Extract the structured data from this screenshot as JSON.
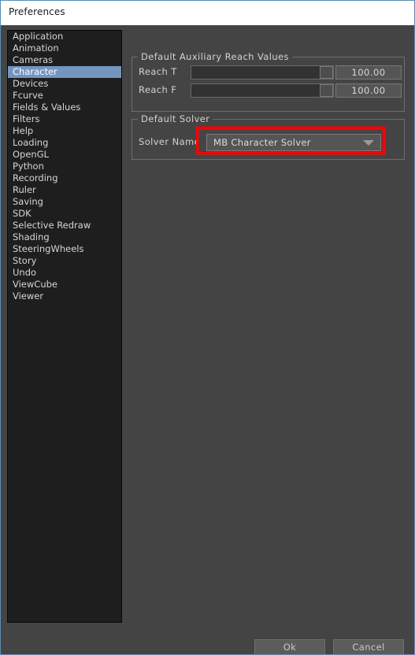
{
  "window": {
    "title": "Preferences",
    "accent_border_color": "#2f9ae0",
    "background_color": "#444444",
    "titlebar_background": "#ffffff"
  },
  "sidebar": {
    "selected": "Character",
    "selected_color": "#7395bf",
    "items": [
      {
        "label": "Application"
      },
      {
        "label": "Animation"
      },
      {
        "label": "Cameras"
      },
      {
        "label": "Character"
      },
      {
        "label": "Devices"
      },
      {
        "label": "Fcurve"
      },
      {
        "label": "Fields & Values"
      },
      {
        "label": "Filters"
      },
      {
        "label": "Help"
      },
      {
        "label": "Loading"
      },
      {
        "label": "OpenGL"
      },
      {
        "label": "Python"
      },
      {
        "label": "Recording"
      },
      {
        "label": "Ruler"
      },
      {
        "label": "Saving"
      },
      {
        "label": "SDK"
      },
      {
        "label": "Selective Redraw"
      },
      {
        "label": "Shading"
      },
      {
        "label": "SteeringWheels"
      },
      {
        "label": "Story"
      },
      {
        "label": "Undo"
      },
      {
        "label": "ViewCube"
      },
      {
        "label": "Viewer"
      }
    ]
  },
  "reach_group": {
    "legend": "Default Auxiliary Reach Values",
    "rows": [
      {
        "label": "Reach T",
        "value": "100.00",
        "slider_percent": 100
      },
      {
        "label": "Reach F",
        "value": "100.00",
        "slider_percent": 100
      }
    ]
  },
  "solver_group": {
    "legend": "Default Solver",
    "label": "Solver Name",
    "selected_option": "MB Character Solver",
    "options": [
      "MB Character Solver"
    ],
    "arrow_icon": "chevron-down-icon"
  },
  "annotation": {
    "highlight_color": "#ff0000",
    "target": "solver-name-dropdown"
  },
  "footer": {
    "ok_label": "Ok",
    "cancel_label": "Cancel"
  }
}
